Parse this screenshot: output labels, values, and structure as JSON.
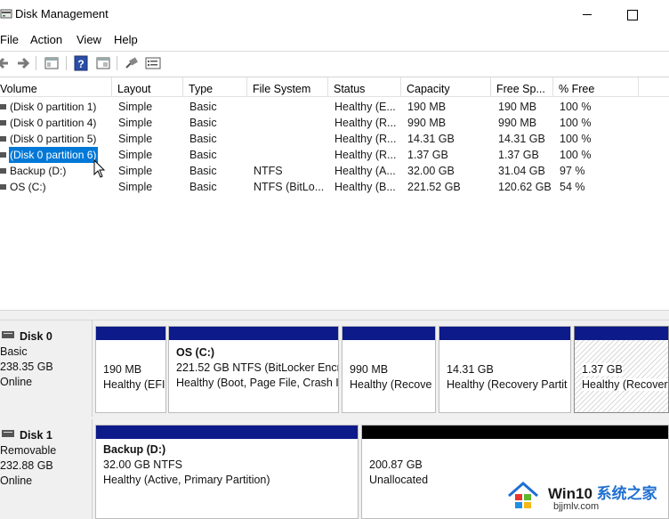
{
  "window": {
    "title": "Disk Management"
  },
  "menu": [
    "File",
    "Action",
    "View",
    "Help"
  ],
  "toolbar": {
    "icons": [
      "back-arrow-icon",
      "forward-arrow-icon",
      "console-tree-icon",
      "help-icon",
      "properties-icon",
      "connect-icon",
      "list-view-icon"
    ]
  },
  "volume_list": {
    "columns": [
      "Volume",
      "Layout",
      "Type",
      "File System",
      "Status",
      "Capacity",
      "Free Sp...",
      "% Free"
    ],
    "rows": [
      {
        "volume": "(Disk 0 partition 1)",
        "layout": "Simple",
        "type": "Basic",
        "fs": "",
        "status": "Healthy (E...",
        "capacity": "190 MB",
        "free": "190 MB",
        "pct": "100 %",
        "selected": false
      },
      {
        "volume": "(Disk 0 partition 4)",
        "layout": "Simple",
        "type": "Basic",
        "fs": "",
        "status": "Healthy (R...",
        "capacity": "990 MB",
        "free": "990 MB",
        "pct": "100 %",
        "selected": false
      },
      {
        "volume": "(Disk 0 partition 5)",
        "layout": "Simple",
        "type": "Basic",
        "fs": "",
        "status": "Healthy (R...",
        "capacity": "14.31 GB",
        "free": "14.31 GB",
        "pct": "100 %",
        "selected": false
      },
      {
        "volume": "(Disk 0 partition 6)",
        "layout": "Simple",
        "type": "Basic",
        "fs": "",
        "status": "Healthy (R...",
        "capacity": "1.37 GB",
        "free": "1.37 GB",
        "pct": "100 %",
        "selected": true
      },
      {
        "volume": "Backup (D:)",
        "layout": "Simple",
        "type": "Basic",
        "fs": "NTFS",
        "status": "Healthy (A...",
        "capacity": "32.00 GB",
        "free": "31.04 GB",
        "pct": "97 %",
        "selected": false
      },
      {
        "volume": "OS (C:)",
        "layout": "Simple",
        "type": "Basic",
        "fs": "NTFS (BitLo...",
        "status": "Healthy (B...",
        "capacity": "221.52 GB",
        "free": "120.62 GB",
        "pct": "54 %",
        "selected": false
      }
    ]
  },
  "disks": [
    {
      "name": "Disk 0",
      "type": "Basic",
      "size": "238.35 GB",
      "state": "Online",
      "partitions": [
        {
          "title": "",
          "size": "190 MB",
          "status": "Healthy (EFI"
        },
        {
          "title": "OS  (C:)",
          "size": "221.52 GB NTFS (BitLocker Encr",
          "status": "Healthy (Boot, Page File, Crash I"
        },
        {
          "title": "",
          "size": "990 MB",
          "status": "Healthy (Recove"
        },
        {
          "title": "",
          "size": "14.31 GB",
          "status": "Healthy (Recovery Partit"
        },
        {
          "title": "",
          "size": "1.37 GB",
          "status": "Healthy (Recovery"
        }
      ]
    },
    {
      "name": "Disk 1",
      "type": "Removable",
      "size": "232.88 GB",
      "state": "Online",
      "partitions": [
        {
          "title": "Backup  (D:)",
          "size": "32.00 GB NTFS",
          "status": "Healthy (Active, Primary Partition)"
        },
        {
          "title": "",
          "size": "200.87 GB",
          "status": "Unallocated"
        }
      ]
    }
  ],
  "watermark": {
    "brand_a": "Win10",
    "brand_b": " 系统之家",
    "url": "bjjmlv.com"
  },
  "colors": {
    "primary_bar": "#0c1a8a",
    "unallocated_bar": "#000000",
    "selection": "#0078d7"
  }
}
